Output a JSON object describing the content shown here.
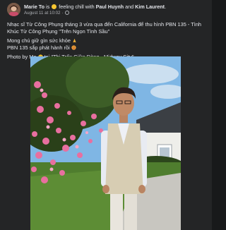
{
  "post": {
    "author": "Marie To",
    "feeling_prefix": "is",
    "feeling_text": "feeling chill with",
    "tagged_1": "Paul Huynh",
    "conjunction": "and",
    "tagged_2": "Kim Laurent",
    "timestamp": "August 11 at 10:02",
    "separator": "·",
    "caption_line_1": "Nhạc sĩ Từ Công Phụng tháng 3 vừa qua đến California để thu hình PBN 135 - Tình Khúc Từ Công Phụng \"Trên Ngọn Tình Sầu\"",
    "caption_line_2": "Mong chú giữ gìn sức khỏe",
    "caption_line_3": "PBN 135 sắp phát hành rồi",
    "caption_photo_prefix": "Photo by Me",
    "caption_photo_at": "tại",
    "caption_location": "\"Thị Trấn Giữa Đàng - Midway City\""
  },
  "colors": {
    "card_bg": "#242526",
    "page_bg": "#18191a",
    "text_primary": "#e4e6eb",
    "text_secondary": "#b0b3b8"
  }
}
